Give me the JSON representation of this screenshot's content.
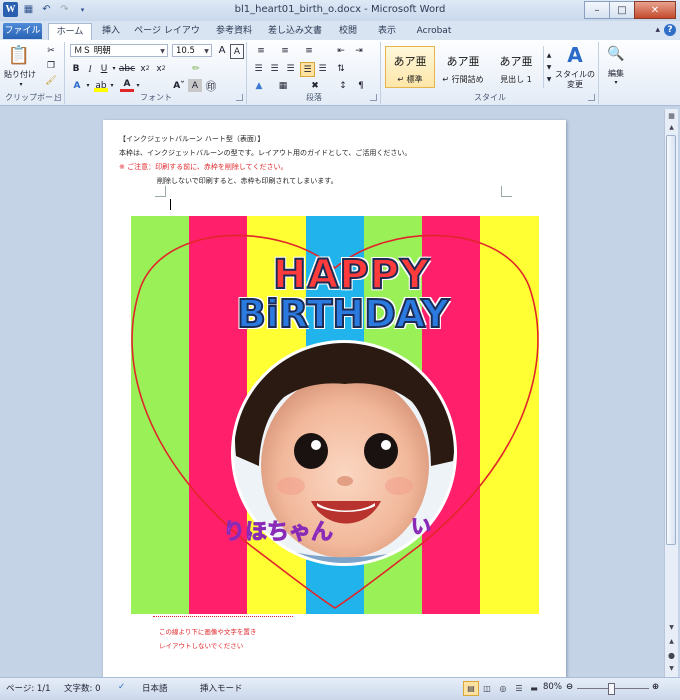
{
  "window": {
    "title": "bl1_heart01_birth_o.docx - Microsoft Word"
  },
  "ribbon_tabs": [
    "ファイル",
    "ホーム",
    "挿入",
    "ページ レイアウト",
    "参考資料",
    "差し込み文書",
    "校閲",
    "表示",
    "Acrobat"
  ],
  "clipboard": {
    "paste_label": "貼り付け",
    "group_label": "クリップボード"
  },
  "font": {
    "name": "ＭＳ 明朝",
    "size": "10.5",
    "group_label": "フォント"
  },
  "paragraph": {
    "group_label": "段落"
  },
  "styles": {
    "group_label": "スタイル",
    "items": [
      {
        "sample": "あア亜",
        "name": "↵ 標準"
      },
      {
        "sample": "あア亜",
        "name": "↵ 行間詰め"
      },
      {
        "sample": "あア亜",
        "name": "見出し 1"
      }
    ],
    "change_label_1": "スタイルの",
    "change_label_2": "変更"
  },
  "editing": {
    "label": "編集"
  },
  "document": {
    "line1": "【インクジェットバルーン ハート型（表面）】",
    "line2": "本枠は、インクジェットバルーンの型です。レイアウト用のガイドとして、ご活用ください。",
    "line3": "※ ご注意：印刷する前に、赤枠を削除してください。",
    "line4": "削除しないで印刷すると、赤枠も印刷されてしまいます。",
    "note1": "この線より下に画像や文字を置き",
    "note2": "レイアウトしないでください",
    "happy": "HAPPY",
    "birthday": "BiRTHDAY",
    "name_text": "りほちゃん",
    "name_tail": "い"
  },
  "status": {
    "page": "ページ: 1/1",
    "words": "文字数: 0",
    "language": "日本語",
    "mode": "挿入モード",
    "zoom": "80%"
  },
  "colors": {
    "stripes": [
      "#99f057",
      "#ff1f6a",
      "#ffff33",
      "#21b4ec",
      "#99f057",
      "#ff1f6a",
      "#ffff33"
    ],
    "heart_outline": "#e0262a",
    "note_red": "#e0262a"
  }
}
